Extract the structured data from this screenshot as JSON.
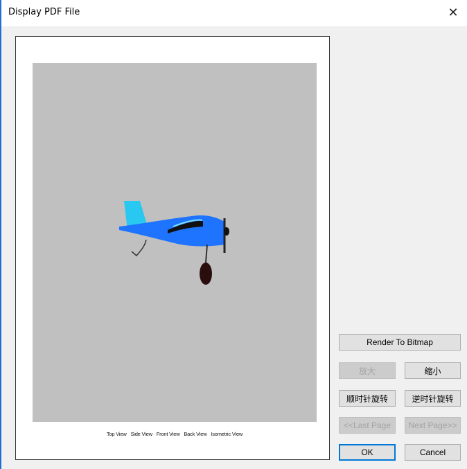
{
  "window": {
    "title": "Display PDF File",
    "close_symbol": "✕",
    "close_icon": "close-icon"
  },
  "document": {
    "caption_items": [
      "Top View",
      "Side View",
      "Front View",
      "Back View",
      "Isometric View"
    ],
    "page_background": "#c0c0c0",
    "image": "airplane-side-view"
  },
  "buttons": {
    "render_to_bitmap": "Render To Bitmap",
    "zoom_in": "放大",
    "zoom_out": "缩小",
    "rotate_clockwise": "顺时针旋转",
    "rotate_counterclockwise": "逆时针旋转",
    "last_page": "<<Last Page",
    "next_page": "Next Page>>",
    "ok": "OK",
    "cancel": "Cancel"
  },
  "states": {
    "zoom_in_enabled": false,
    "last_page_enabled": false,
    "next_page_enabled": false,
    "default_button": "ok"
  },
  "colors": {
    "accent": "#0078d7",
    "plane_body": "#1e73ff",
    "plane_tail": "#29c8f0",
    "plane_wheel": "#2a0d0d"
  }
}
